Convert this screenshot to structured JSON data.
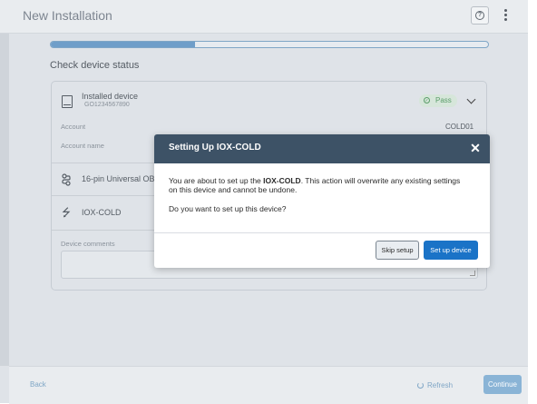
{
  "header": {
    "title": "New Installation"
  },
  "progress": {
    "fraction": 0.33
  },
  "section": {
    "title": "Check device status"
  },
  "device": {
    "name": "Installed device",
    "id": "GO1234567890",
    "status": "Pass",
    "account_label": "Account",
    "account_value": "COLD01",
    "account_name_label": "Account name",
    "harness_label": "16-pin Universal OB",
    "iox_label": "IOX-COLD",
    "comments_label": "Device comments"
  },
  "modal": {
    "title": "Setting Up IOX-COLD",
    "close_glyph": "✕",
    "body_prefix": "You are about to set up the ",
    "body_bold": "IOX-COLD",
    "body_suffix": ". This action will overwrite any existing settings on this device and cannot be undone.",
    "question": "Do you want to set up this device?",
    "skip_label": "Skip setup",
    "setup_label": "Set up device"
  },
  "footer": {
    "back_label": "Back",
    "refresh_label": "Refresh",
    "continue_label": "Continue"
  },
  "icons": {
    "help": "question-icon",
    "menu": "kebab-icon",
    "device": "device-icon",
    "harness": "harness-icon",
    "usb": "usb-icon"
  },
  "colors": {
    "header_bar": "#3d5266",
    "primary_button": "#1a73c7",
    "pass_green": "#5a9d69"
  }
}
